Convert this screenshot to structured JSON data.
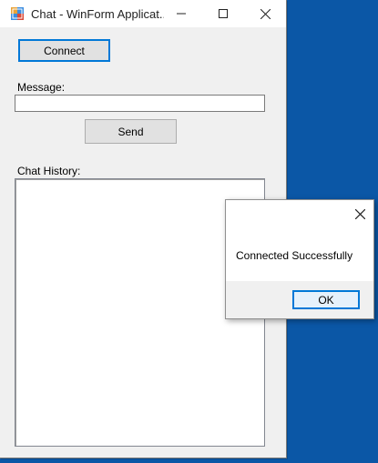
{
  "window": {
    "title": "Chat - WinForm Applicat...",
    "app_icon": "winform-app-icon"
  },
  "form": {
    "connect_label": "Connect",
    "message_label": "Message:",
    "message_value": "",
    "send_label": "Send",
    "history_label": "Chat History:",
    "history_value": ""
  },
  "dialog": {
    "message": "Connected Successfully",
    "ok_label": "OK"
  },
  "colors": {
    "desktop": "#0b57a6",
    "accent": "#0078d7"
  }
}
